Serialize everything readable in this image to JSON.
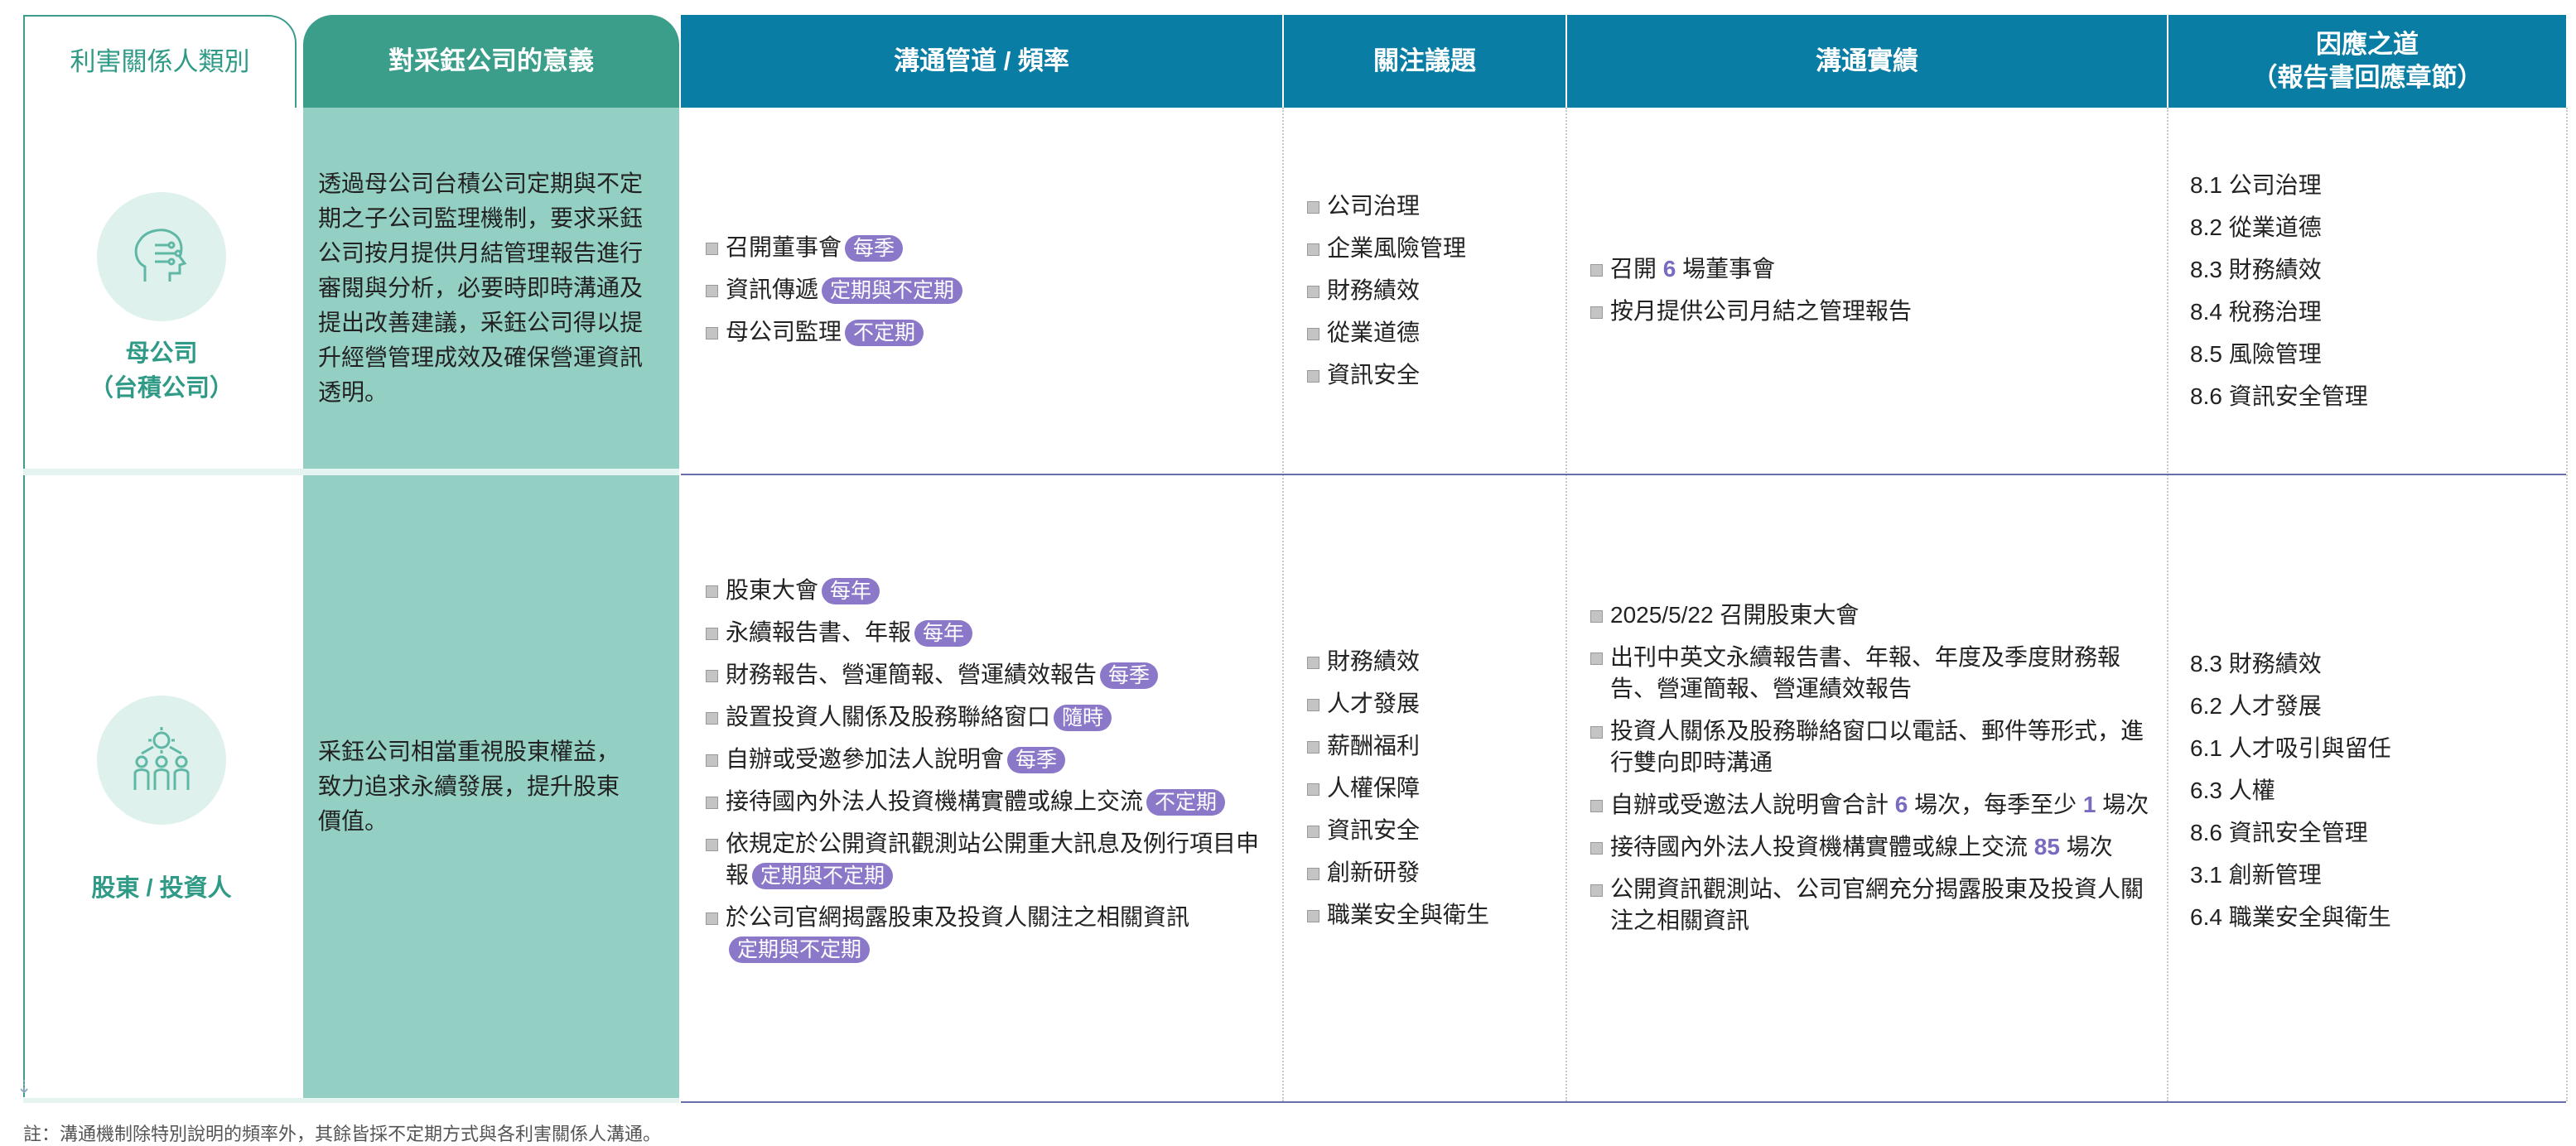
{
  "headers": {
    "category": "利害關係人類別",
    "significance": "對采鈺公司的意義",
    "channel": "溝通管道 / 頻率",
    "issues": "關注議題",
    "achievements": "溝通實績",
    "response_line1": "因應之道",
    "response_line2": "（報告書回應章節）"
  },
  "rows": [
    {
      "icon": "brain-icon",
      "name_line1": "母公司",
      "name_line2": "（台積公司）",
      "significance_lines": [
        "透過母公司台積公司定期與不定",
        "期之子公司監理機制，要求采鈺",
        "公司按月提供月結管理報告進行",
        "審閱與分析，必要時即時溝通及",
        "提出改善建議，采鈺公司得以提",
        "升經營管理成效及確保營運資訊",
        "透明。"
      ],
      "channels": [
        {
          "text": "召開董事會",
          "tag": "每季"
        },
        {
          "text": "資訊傳遞",
          "tag": "定期與不定期"
        },
        {
          "text": "母公司監理",
          "tag": "不定期"
        }
      ],
      "issues": [
        "公司治理",
        "企業風險管理",
        "財務績效",
        "從業道德",
        "資訊安全"
      ],
      "achievements": [
        {
          "pre": "召開 ",
          "num": "6",
          "post": " 場董事會"
        },
        {
          "pre": "按月提供公司月結之管理報告",
          "num": "",
          "post": ""
        }
      ],
      "responses": [
        "8.1 公司治理",
        "8.2 從業道德",
        "8.3 財務績效",
        "8.4 稅務治理",
        "8.5 風險管理",
        "8.6 資訊安全管理"
      ]
    },
    {
      "icon": "investor-group-icon",
      "name_line1": "股東 / 投資人",
      "significance_lines": [
        "采鈺公司相當重視股東權益，",
        "致力追求永續發展，提升股東",
        "價值。"
      ],
      "channels": [
        {
          "text": "股東大會",
          "tag": "每年"
        },
        {
          "text": "永續報告書、年報",
          "tag": "每年"
        },
        {
          "text": "財務報告、營運簡報、營運績效報告",
          "tag": "每季"
        },
        {
          "text": "設置投資人關係及股務聯絡窗口",
          "tag": "隨時"
        },
        {
          "text": "自辦或受邀參加法人說明會",
          "tag": "每季"
        },
        {
          "text": "接待國內外法人投資機構實體或線上交流",
          "tag": "不定期"
        },
        {
          "text": "依規定於公開資訊觀測站公開重大訊息及例行項目申報",
          "tag": "定期與不定期"
        },
        {
          "text": "於公司官網揭露股東及投資人關注之相關資訊",
          "tag": "定期與不定期"
        }
      ],
      "issues": [
        "財務績效",
        "人才發展",
        "薪酬福利",
        "人權保障",
        "資訊安全",
        "創新研發",
        "職業安全與衛生"
      ],
      "achievements": [
        {
          "pre": "2025/5/22 召開股東大會",
          "num": "",
          "post": ""
        },
        {
          "pre": "出刊中英文永續報告書、年報、年度及季度財務報告、營運簡報、營運績效報告",
          "num": "",
          "post": ""
        },
        {
          "pre": "投資人關係及股務聯絡窗口以電話、郵件等形式，進行雙向即時溝通",
          "num": "",
          "post": ""
        },
        {
          "pre": "自辦或受邀法人說明會合計 ",
          "num": "6",
          "post": " 場次，每季至少 ",
          "num2": "1",
          "post2": " 場次"
        },
        {
          "pre": "接待國內外法人投資機構實體或線上交流 ",
          "num": "85",
          "post": " 場次"
        },
        {
          "pre": "公開資訊觀測站、公司官網充分揭露股東及投資人關注之相關資訊",
          "num": "",
          "post": ""
        }
      ],
      "responses": [
        "8.3 財務績效",
        "6.2 人才發展",
        "6.1 人才吸引與留任",
        "6.3 人權",
        "8.6 資訊安全管理",
        "3.1 創新管理",
        "6.4 職業安全與衛生"
      ]
    }
  ],
  "footnote": "註：溝通機制除特別說明的頻率外，其餘皆採不定期方式與各利害關係人溝通。",
  "colors": {
    "teal": "#3b9e8b",
    "teal_light": "#93cfc3",
    "blue": "#0a7da5",
    "tag": "#8b78c8"
  }
}
